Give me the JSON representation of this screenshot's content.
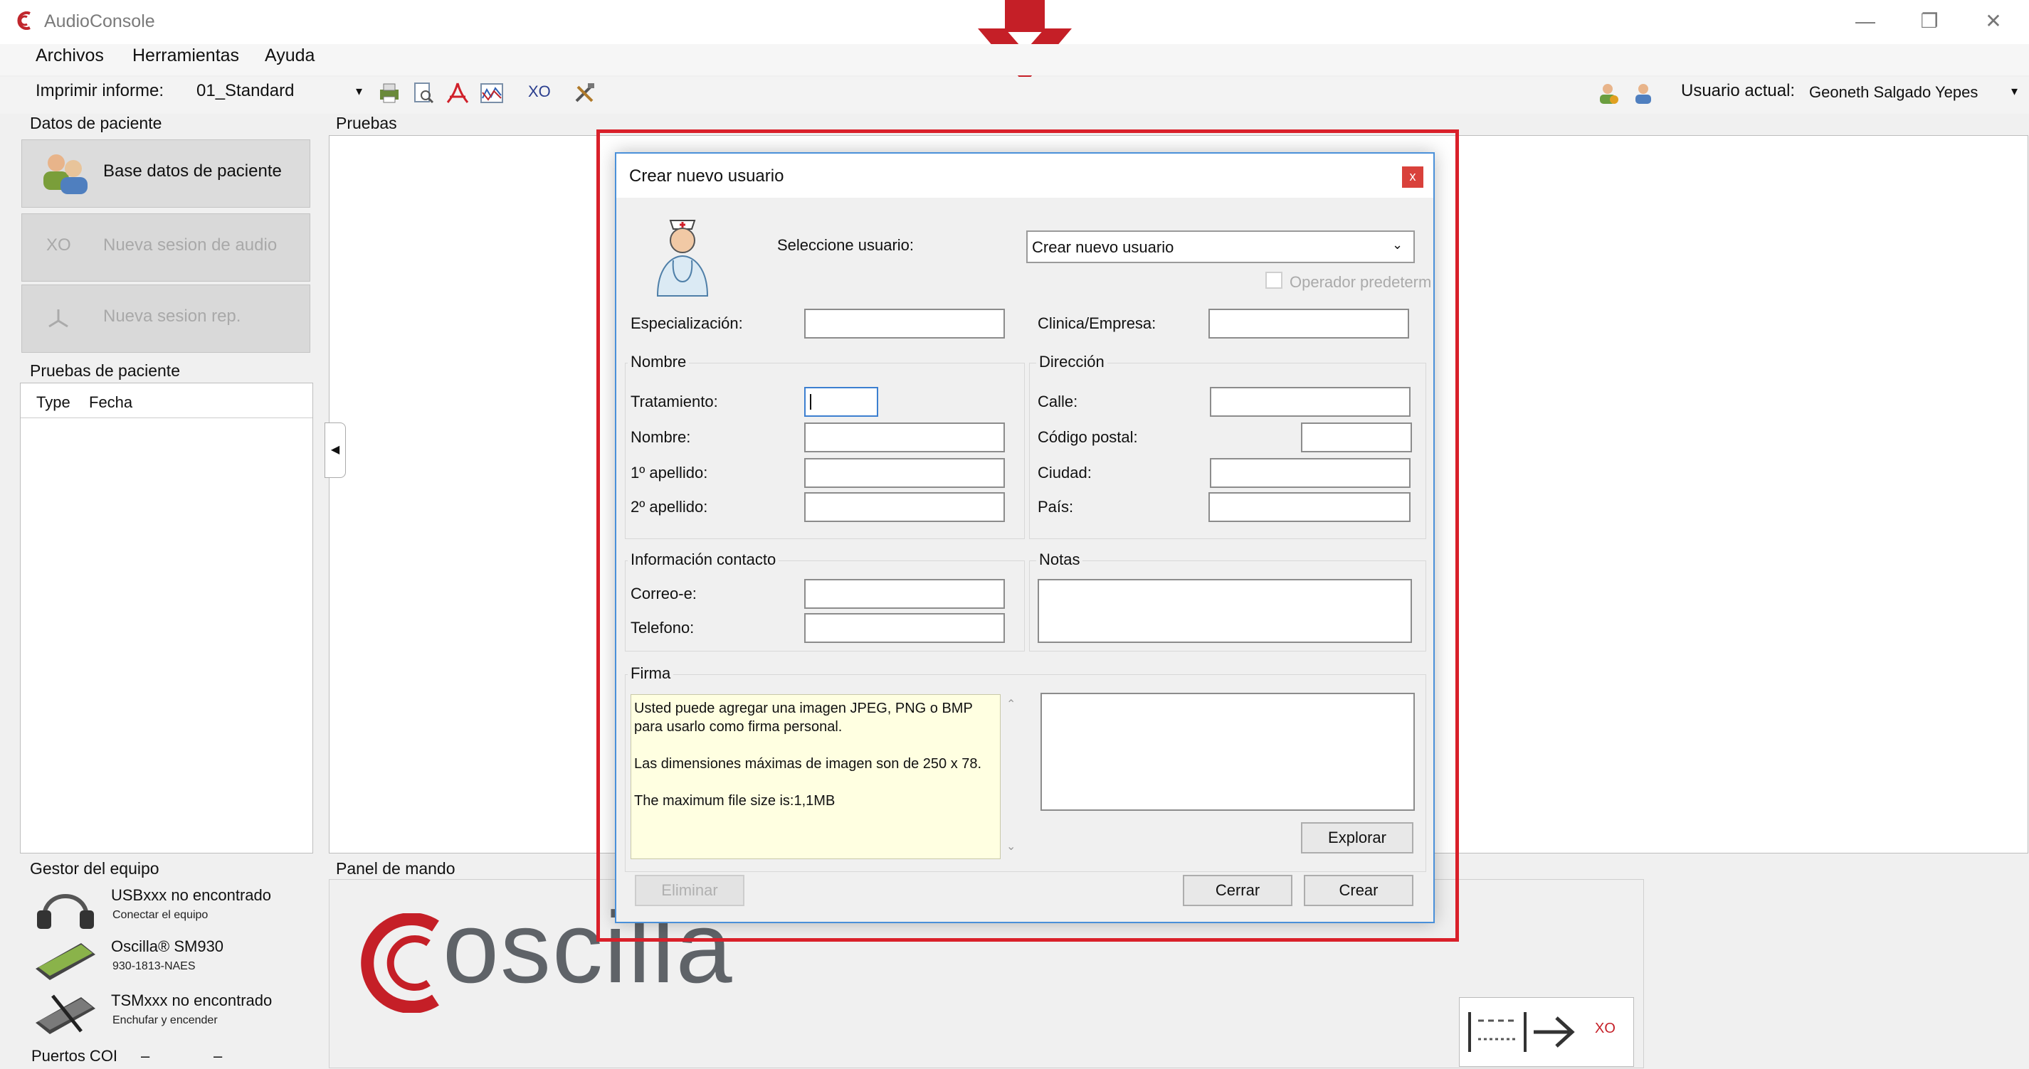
{
  "app": {
    "title": "AudioConsole"
  },
  "menu": [
    "Archivos",
    "Herramientas",
    "Ayuda"
  ],
  "toolbar": {
    "report_label": "Imprimir informe:",
    "report_value": "01_Standard",
    "xo_label": "XO",
    "user_label": "Usuario actual:",
    "user_value": "Geoneth Salgado Yepes"
  },
  "left_panel": {
    "title": "Datos de paciente",
    "buttons": [
      "Base datos de paciente",
      "Nueva sesion de audio",
      "Nueva sesion rep."
    ],
    "xo_tag": "XO",
    "tests_title": "Pruebas de paciente",
    "columns": [
      "Type",
      "Fecha"
    ]
  },
  "tests_panel": {
    "title": "Pruebas"
  },
  "device_panel": {
    "title": "Gestor del equipo",
    "devices": [
      {
        "name": "USBxxx no encontrado",
        "sub": "Conectar el equipo"
      },
      {
        "name": "Oscilla® SM930",
        "sub": "930-1813-NAES"
      },
      {
        "name": "TSMxxx no encontrado",
        "sub": "Enchufar y encender"
      }
    ],
    "ports_label": "Puertos COI",
    "ports_value1": "–",
    "ports_value2": "–"
  },
  "control_panel": {
    "title": "Panel de mando",
    "brand": "oscilla",
    "xo_small": "XO"
  },
  "dialog": {
    "title": "Crear nuevo usuario",
    "close": "x",
    "select_label": "Seleccione usuario:",
    "select_value": "Crear nuevo usuario",
    "default_operator": "Operador predetermi",
    "specialization_label": "Especialización:",
    "company_label": "Clinica/Empresa:",
    "name_group": "Nombre",
    "treatment_label": "Tratamiento:",
    "name_label": "Nombre:",
    "surname1_label": "1º apellido:",
    "surname2_label": "2º apellido:",
    "address_group": "Dirección",
    "street_label": "Calle:",
    "postal_label": "Código postal:",
    "city_label": "Ciudad:",
    "country_label": "País:",
    "contact_group": "Información contacto",
    "email_label": "Correo-e:",
    "phone_label": "Telefono:",
    "notes_group": "Notas",
    "signature_group": "Firma",
    "signature_info": "Usted puede agregar una imagen JPEG, PNG o BMP para usarlo como firma personal.\n\nLas dimensiones máximas de imagen son de 250 x 78.\n\nThe maximum file size is:1,1MB",
    "browse": "Explorar",
    "delete": "Eliminar",
    "close_btn": "Cerrar",
    "create_btn": "Crear"
  },
  "colors": {
    "highlight_red": "#d9202a",
    "dialog_border": "#4a90d9",
    "info_bg": "#ffffe1"
  },
  "icons": [
    "audioconsole-logo-icon",
    "printer-icon",
    "preview-icon",
    "pdf-icon",
    "wave-icon",
    "tools-icon",
    "user-icon",
    "arrow-down-icon",
    "nurse-icon"
  ]
}
